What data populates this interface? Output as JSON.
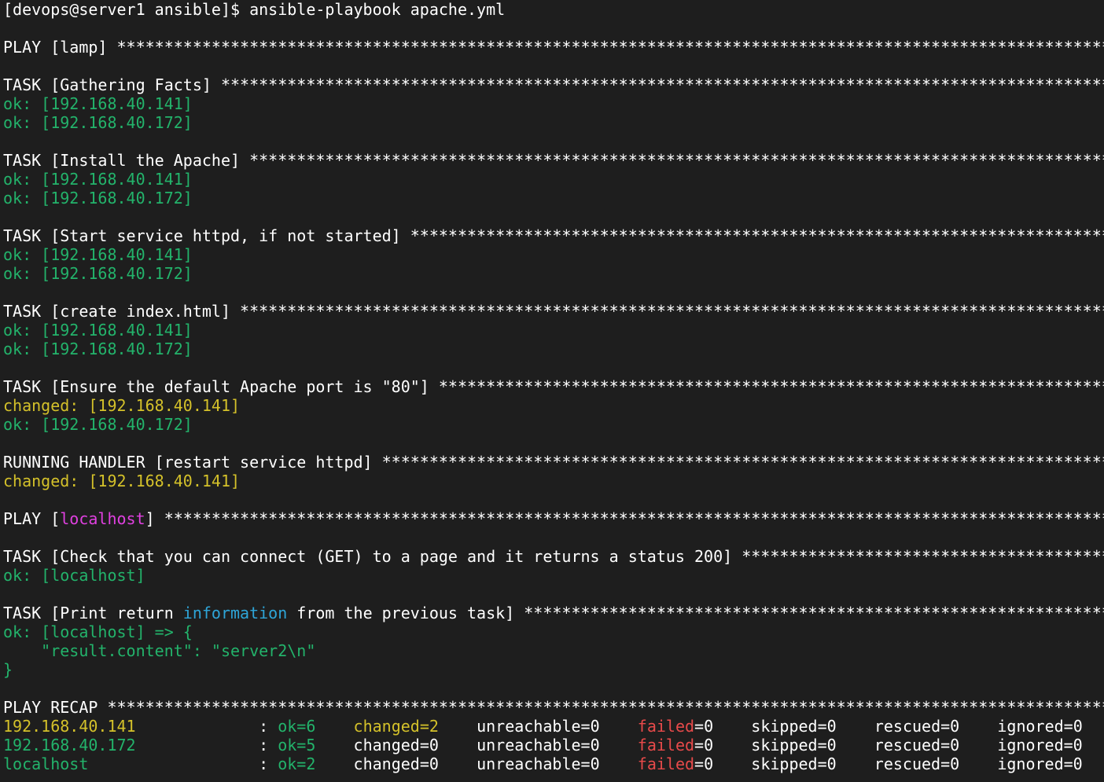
{
  "colors": {
    "background": "#1e1e1e",
    "default_text": "#ffffff",
    "ok": "#23b36b",
    "changed": "#d4c12a",
    "host_highlight": "#e040e0",
    "keyword": "#2ea5d8",
    "failed": "#e84a4a"
  },
  "lines": [
    {
      "segments": [
        {
          "text": "[devops@server1 ansible]$ ansible-playbook apache.yml",
          "color": "w"
        }
      ]
    },
    {
      "segments": []
    },
    {
      "segments": [
        {
          "text": "PLAY [lamp] ",
          "color": "w"
        },
        {
          "text": "***************************************************************************************************************************************************",
          "color": "w"
        }
      ]
    },
    {
      "segments": []
    },
    {
      "segments": [
        {
          "text": "TASK [Gathering Facts] ",
          "color": "w"
        },
        {
          "text": "**********************************************************************************************************************************",
          "color": "w"
        }
      ]
    },
    {
      "segments": [
        {
          "text": "ok: [192.168.40.141]",
          "color": "green-ok"
        }
      ]
    },
    {
      "segments": [
        {
          "text": "ok: [192.168.40.172]",
          "color": "green-ok"
        }
      ]
    },
    {
      "segments": []
    },
    {
      "segments": [
        {
          "text": "TASK [Install the Apache] ",
          "color": "w"
        },
        {
          "text": "*******************************************************************************************************************************",
          "color": "w"
        }
      ]
    },
    {
      "segments": [
        {
          "text": "ok: [192.168.40.141]",
          "color": "green-ok"
        }
      ]
    },
    {
      "segments": [
        {
          "text": "ok: [192.168.40.172]",
          "color": "green-ok"
        }
      ]
    },
    {
      "segments": []
    },
    {
      "segments": [
        {
          "text": "TASK [Start service httpd, if not started] ",
          "color": "w"
        },
        {
          "text": "**************************************************************************************************************",
          "color": "w"
        }
      ]
    },
    {
      "segments": [
        {
          "text": "ok: [192.168.40.141]",
          "color": "green-ok"
        }
      ]
    },
    {
      "segments": [
        {
          "text": "ok: [192.168.40.172]",
          "color": "green-ok"
        }
      ]
    },
    {
      "segments": []
    },
    {
      "segments": [
        {
          "text": "TASK [create index.html] ",
          "color": "w"
        },
        {
          "text": "********************************************************************************************************************************",
          "color": "w"
        }
      ]
    },
    {
      "segments": [
        {
          "text": "ok: [192.168.40.141]",
          "color": "green-ok"
        }
      ]
    },
    {
      "segments": [
        {
          "text": "ok: [192.168.40.172]",
          "color": "green-ok"
        }
      ]
    },
    {
      "segments": []
    },
    {
      "segments": [
        {
          "text": "TASK [Ensure the default Apache port is \"80\"] ",
          "color": "w"
        },
        {
          "text": "***********************************************************************************************************",
          "color": "w"
        }
      ]
    },
    {
      "segments": [
        {
          "text": "changed: [192.168.40.141]",
          "color": "yellow"
        }
      ]
    },
    {
      "segments": [
        {
          "text": "ok: [192.168.40.172]",
          "color": "green-ok"
        }
      ]
    },
    {
      "segments": []
    },
    {
      "segments": [
        {
          "text": "RUNNING HANDLER [restart service httpd] ",
          "color": "w"
        },
        {
          "text": "*****************************************************************************************************************",
          "color": "w"
        }
      ]
    },
    {
      "segments": [
        {
          "text": "changed: [192.168.40.141]",
          "color": "yellow"
        }
      ]
    },
    {
      "segments": []
    },
    {
      "segments": [
        {
          "text": "PLAY [",
          "color": "w"
        },
        {
          "text": "localhost",
          "color": "magenta"
        },
        {
          "text": "] ",
          "color": "w"
        },
        {
          "text": "**********************************************************************************************************************************************",
          "color": "w"
        }
      ]
    },
    {
      "segments": []
    },
    {
      "segments": [
        {
          "text": "TASK [Check that you can connect (GET) to a page and it returns a status 200] ",
          "color": "w"
        },
        {
          "text": "**************************************************************************",
          "color": "w"
        }
      ]
    },
    {
      "segments": [
        {
          "text": "ok: [localhost]",
          "color": "green-ok"
        }
      ]
    },
    {
      "segments": []
    },
    {
      "segments": [
        {
          "text": "TASK [Print return ",
          "color": "w"
        },
        {
          "text": "information",
          "color": "blue"
        },
        {
          "text": " from the previous task] ",
          "color": "w"
        },
        {
          "text": "*******************************************************************************************",
          "color": "w"
        }
      ]
    },
    {
      "segments": [
        {
          "text": "ok: [localhost] => {",
          "color": "green-ok"
        }
      ]
    },
    {
      "segments": [
        {
          "text": "    \"result.content\": \"server2\\n\"",
          "color": "green-ok"
        }
      ]
    },
    {
      "segments": [
        {
          "text": "}",
          "color": "green-ok"
        }
      ]
    },
    {
      "segments": []
    },
    {
      "segments": [
        {
          "text": "PLAY RECAP ",
          "color": "w"
        },
        {
          "text": "**********************************************************************************************************************************************",
          "color": "w"
        }
      ]
    },
    {
      "segments": [
        {
          "text": "192.168.40.141             ",
          "color": "yellow"
        },
        {
          "text": ": ",
          "color": "w"
        },
        {
          "text": "ok=6",
          "color": "green-ok"
        },
        {
          "text": "    ",
          "color": "w"
        },
        {
          "text": "changed=2",
          "color": "yellow"
        },
        {
          "text": "    unreachable=0    ",
          "color": "w"
        },
        {
          "text": "failed",
          "color": "red"
        },
        {
          "text": "=0    skipped=0    rescued=0    ignored=0",
          "color": "w"
        }
      ]
    },
    {
      "segments": [
        {
          "text": "192.168.40.172             ",
          "color": "green-ok"
        },
        {
          "text": ": ",
          "color": "w"
        },
        {
          "text": "ok=5",
          "color": "green-ok"
        },
        {
          "text": "    changed=0    unreachable=0    ",
          "color": "w"
        },
        {
          "text": "failed",
          "color": "red"
        },
        {
          "text": "=0    skipped=0    rescued=0    ignored=0",
          "color": "w"
        }
      ]
    },
    {
      "segments": [
        {
          "text": "localhost                  ",
          "color": "green-ok"
        },
        {
          "text": ": ",
          "color": "w"
        },
        {
          "text": "ok=2",
          "color": "green-ok"
        },
        {
          "text": "    changed=0    unreachable=0    ",
          "color": "w"
        },
        {
          "text": "failed",
          "color": "red"
        },
        {
          "text": "=0    skipped=0    rescued=0    ignored=0",
          "color": "w"
        }
      ]
    }
  ]
}
